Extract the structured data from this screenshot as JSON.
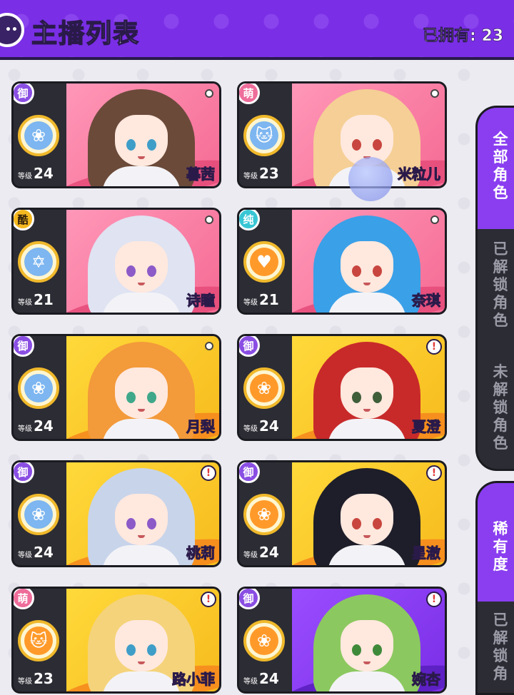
{
  "header": {
    "title": "主播列表",
    "owned_label": "已拥有: 23",
    "back_icon": "back-arrow-icon"
  },
  "cards": [
    {
      "badge": "御",
      "bg": "pink",
      "skill": "rose",
      "skill_color": "blue",
      "level_label": "等级",
      "level": "24",
      "name": "暮茜",
      "marker": "dot",
      "hair": "#6b4a3a",
      "eye": "#3f9ec8"
    },
    {
      "badge": "萌",
      "bg": "pink",
      "skill": "cat",
      "skill_color": "blue",
      "level_label": "等级",
      "level": "23",
      "name": "米粒儿",
      "marker": "dot",
      "hair": "#f5cf95",
      "eye": "#c8463f"
    },
    {
      "badge": "酷",
      "bg": "pink",
      "skill": "star",
      "skill_color": "blue",
      "level_label": "等级",
      "level": "21",
      "name": "诗瞳",
      "marker": "dot",
      "hair": "#dfe3f2",
      "eye": "#8c5bc8"
    },
    {
      "badge": "纯",
      "bg": "pink",
      "skill": "heartbeat",
      "skill_color": "orange",
      "level_label": "等级",
      "level": "21",
      "name": "奈琪",
      "marker": "dot",
      "hair": "#3aa0e8",
      "eye": "#c8463f"
    },
    {
      "badge": "御",
      "bg": "yellow",
      "skill": "rose",
      "skill_color": "blue",
      "level_label": "等级",
      "level": "24",
      "name": "月梨",
      "marker": "dot",
      "hair": "#f39a3a",
      "eye": "#3fa88a"
    },
    {
      "badge": "御",
      "bg": "yellow",
      "skill": "rose",
      "skill_color": "orange",
      "level_label": "等级",
      "level": "24",
      "name": "夏澄",
      "marker": "alert",
      "hair": "#c82a2a",
      "eye": "#3f5e3a"
    },
    {
      "badge": "御",
      "bg": "yellow",
      "skill": "rose",
      "skill_color": "blue",
      "level_label": "等级",
      "level": "24",
      "name": "桃莉",
      "marker": "alert",
      "hair": "#c8d4ea",
      "eye": "#8c5bc8"
    },
    {
      "badge": "御",
      "bg": "yellow",
      "skill": "rose",
      "skill_color": "orange",
      "level_label": "等级",
      "level": "24",
      "name": "星澈",
      "marker": "alert",
      "hair": "#1e1e2a",
      "eye": "#c8463f"
    },
    {
      "badge": "萌",
      "bg": "yellow",
      "skill": "cat",
      "skill_color": "orange",
      "level_label": "等级",
      "level": "23",
      "name": "路小菲",
      "marker": "alert",
      "hair": "#f5d37a",
      "eye": "#3f9ec8"
    },
    {
      "badge": "御",
      "bg": "purple",
      "skill": "rose",
      "skill_color": "orange",
      "level_label": "等级",
      "level": "24",
      "name": "婉杏",
      "marker": "alert",
      "hair": "#8cc860",
      "eye": "#3f8a3a"
    }
  ],
  "side_tabs": {
    "all": "全部角色",
    "unlocked": "已解锁角色",
    "locked": "未解锁角色"
  },
  "side_tabs2": {
    "rarity": "稀有度",
    "unlocked": "已解锁角"
  },
  "colors": {
    "accent": "#7a2ee6",
    "badge_yu": "#8a4ee3",
    "badge_meng": "#ee6d9a",
    "badge_ku": "#f5b81f",
    "badge_chun": "#38c6d4"
  }
}
